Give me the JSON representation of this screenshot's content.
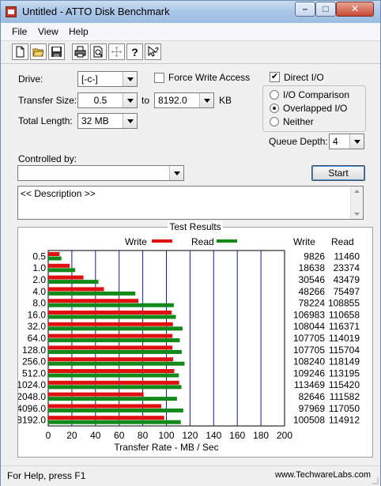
{
  "window": {
    "title": "Untitled - ATTO Disk Benchmark"
  },
  "menu": [
    "File",
    "View",
    "Help"
  ],
  "toolbar_icons": [
    "new-file-icon",
    "open-folder-icon",
    "save-icon",
    "print-icon",
    "print-preview-icon",
    "move-icon",
    "help-icon",
    "context-help-icon"
  ],
  "form": {
    "drive_label": "Drive:",
    "drive_value": "[-c-]",
    "force_write_label": "Force Write Access",
    "direct_io_label": "Direct I/O",
    "direct_io_checked": true,
    "transfer_size_label": "Transfer Size:",
    "transfer_from": "0.5",
    "transfer_to_label": "to",
    "transfer_to": "8192.0",
    "transfer_unit": "KB",
    "total_length_label": "Total Length:",
    "total_length_value": "32 MB",
    "io_comparison_label": "I/O Comparison",
    "overlapped_io_label": "Overlapped I/O",
    "neither_label": "Neither",
    "queue_depth_label": "Queue Depth:",
    "queue_depth_value": "4",
    "controlled_by_label": "Controlled by:",
    "controlled_by_value": "",
    "start_label": "Start",
    "description_text": "<< Description >>"
  },
  "results": {
    "title": "Test Results",
    "write_legend": "Write",
    "read_legend": "Read",
    "write_col": "Write",
    "read_col": "Read",
    "write_color": "#e01010",
    "read_color": "#118a1a"
  },
  "chart_data": {
    "type": "bar",
    "orientation": "horizontal",
    "xlabel": "Transfer Rate - MB / Sec",
    "xlim": [
      0,
      200
    ],
    "xticks": [
      0,
      20,
      40,
      60,
      80,
      100,
      120,
      140,
      160,
      180,
      200
    ],
    "categories": [
      "0.5",
      "1.0",
      "2.0",
      "4.0",
      "8.0",
      "16.0",
      "32.0",
      "64.0",
      "128.0",
      "256.0",
      "512.0",
      "1024.0",
      "2048.0",
      "4096.0",
      "8192.0"
    ],
    "series": [
      {
        "name": "Write",
        "values": [
          9826,
          18638,
          30546,
          48266,
          78224,
          106983,
          108044,
          107705,
          107705,
          108240,
          109246,
          113469,
          82646,
          97969,
          100508
        ]
      },
      {
        "name": "Read",
        "values": [
          11460,
          23374,
          43479,
          75497,
          108855,
          110658,
          116371,
          114019,
          115704,
          118149,
          113195,
          115420,
          111582,
          117050,
          114912
        ]
      }
    ],
    "units_note": "Values in KB/s; bars plotted in MB/s"
  },
  "status": {
    "text": "For Help, press F1",
    "watermark": "www.TechwareLabs.com"
  }
}
